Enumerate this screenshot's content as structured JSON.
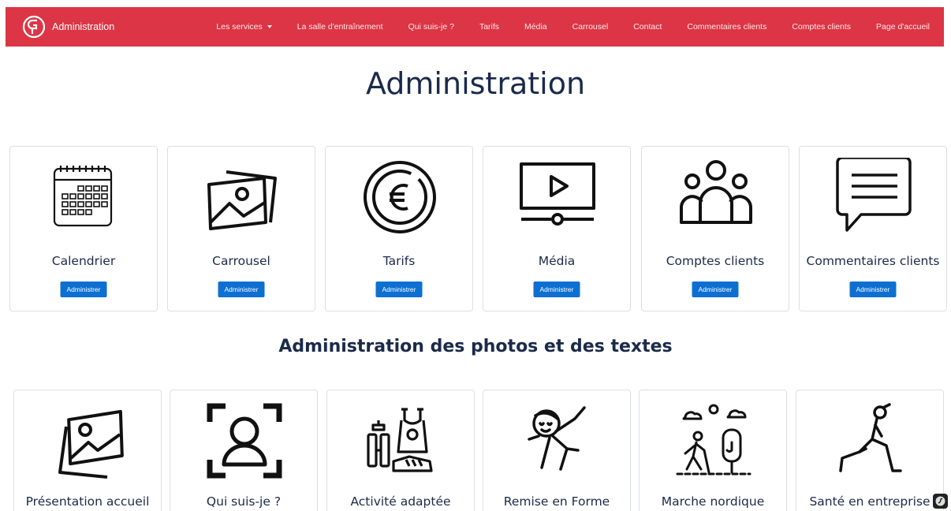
{
  "navbar": {
    "brand_text": "Administration",
    "links": [
      {
        "label": "Les services",
        "has_caret": true
      },
      {
        "label": "La salle d'entraînement"
      },
      {
        "label": "Qui suis-je ?"
      },
      {
        "label": "Tarifs"
      },
      {
        "label": "Média"
      },
      {
        "label": "Carrousel"
      },
      {
        "label": "Contact"
      },
      {
        "label": "Commentaires clients"
      },
      {
        "label": "Comptes clients"
      },
      {
        "label": "Page d'accueil"
      }
    ]
  },
  "page_title": "Administration",
  "admin_cards": [
    {
      "title": "Calendrier",
      "icon": "calendar-icon",
      "button": "Administrer"
    },
    {
      "title": "Carrousel",
      "icon": "images-icon",
      "button": "Administrer"
    },
    {
      "title": "Tarifs",
      "icon": "euro-coin-icon",
      "button": "Administrer"
    },
    {
      "title": "Média",
      "icon": "video-player-icon",
      "button": "Administrer"
    },
    {
      "title": "Comptes clients",
      "icon": "users-group-icon",
      "button": "Administrer"
    },
    {
      "title": "Commentaires clients",
      "icon": "comment-bubble-icon",
      "button": "Administrer"
    }
  ],
  "section_title": "Administration des photos et des textes",
  "content_cards": [
    {
      "title": "Présentation accueil",
      "icon": "photo-icon"
    },
    {
      "title": "Qui suis-je ?",
      "icon": "user-scan-icon"
    },
    {
      "title": "Activité adaptée",
      "icon": "fitness-gear-icon"
    },
    {
      "title": "Remise en Forme",
      "icon": "stretching-person-icon"
    },
    {
      "title": "Marche nordique",
      "icon": "nordic-walking-icon"
    },
    {
      "title": "Santé en entreprise",
      "icon": "lunge-exercise-icon"
    }
  ],
  "colors": {
    "navbar": "#dc3545",
    "button": "#0d6fd1",
    "text": "#1b2a4a"
  }
}
